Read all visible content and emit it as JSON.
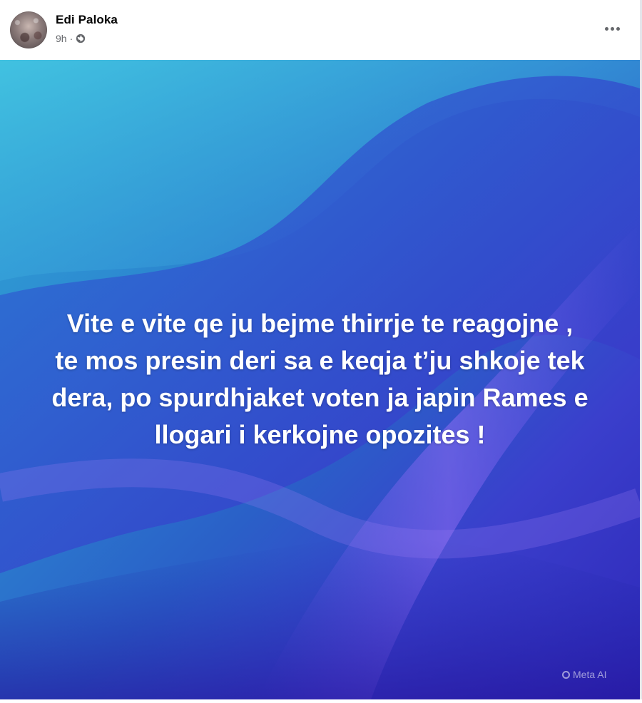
{
  "post": {
    "author_name": "Edi Paloka",
    "timestamp": "9h",
    "separator": "·",
    "audience_icon": "globe-icon",
    "more_icon": "more-options-icon",
    "text_lines": [
      "Vite e vite qe ju bejme thirrje te reagojne ,",
      "te mos presin deri sa e keqja t’ju shkoje tek",
      "dera, po spurdhjaket voten ja japin Rames e",
      "llogari i kerkojne opozites !"
    ],
    "watermark": "Meta AI"
  },
  "colors": {
    "name": "#050505",
    "meta": "#65676b",
    "background_light": "#31a9d6",
    "background_dark": "#2e27b8"
  }
}
